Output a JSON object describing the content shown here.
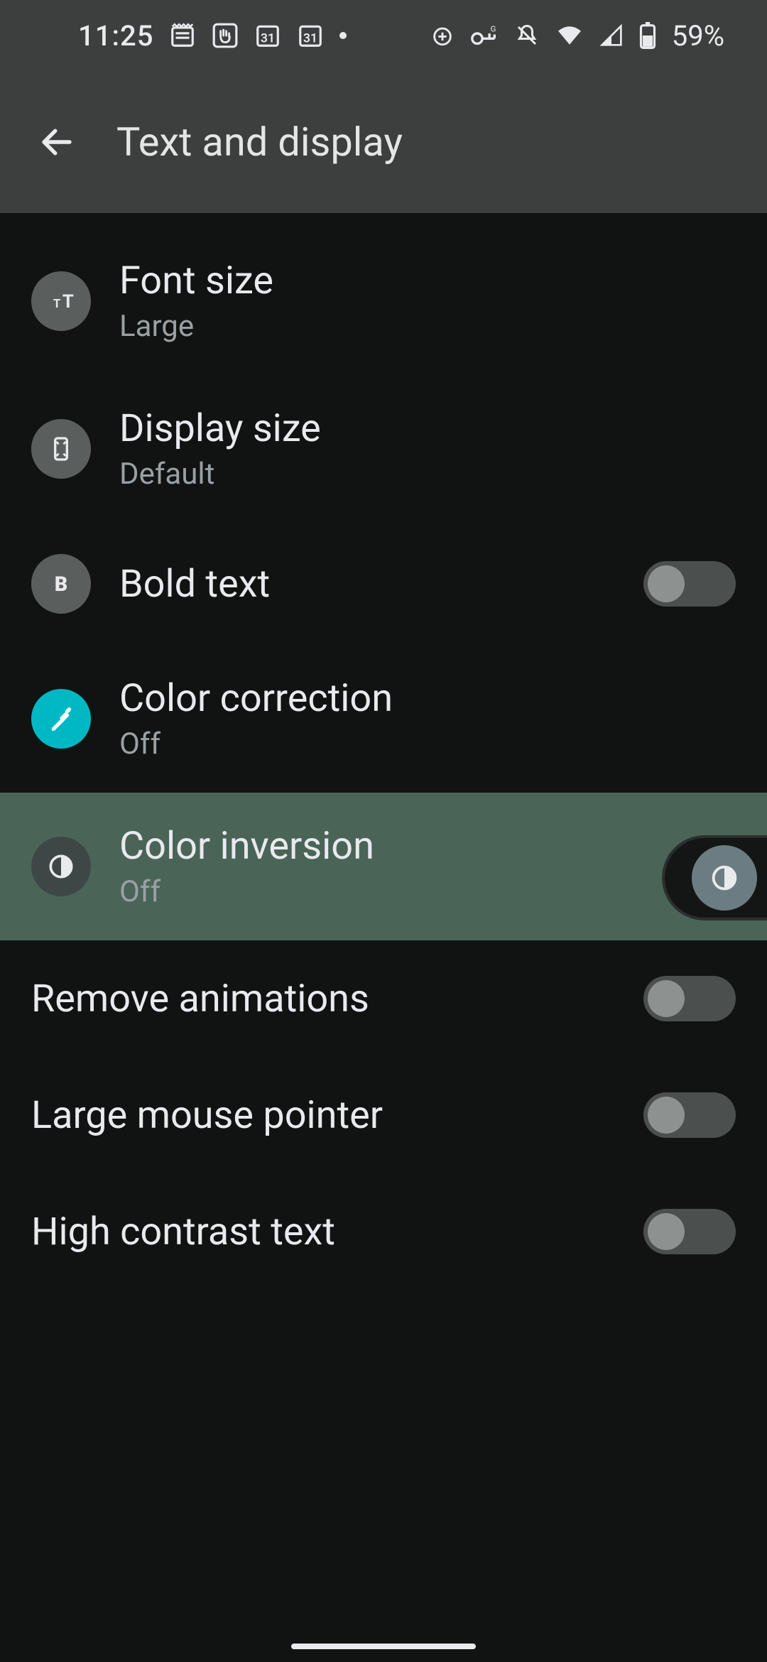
{
  "status": {
    "time": "11:25",
    "battery": "59%"
  },
  "appbar": {
    "title": "Text and display"
  },
  "rows": {
    "font_size": {
      "title": "Font size",
      "subtitle": "Large"
    },
    "display_size": {
      "title": "Display size",
      "subtitle": "Default"
    },
    "bold_text": {
      "title": "Bold text"
    },
    "color_correction": {
      "title": "Color correction",
      "subtitle": "Off"
    },
    "color_inversion": {
      "title": "Color inversion",
      "subtitle": "Off"
    },
    "remove_animations": {
      "title": "Remove animations"
    },
    "large_pointer": {
      "title": "Large mouse pointer"
    },
    "high_contrast": {
      "title": "High contrast text"
    }
  }
}
